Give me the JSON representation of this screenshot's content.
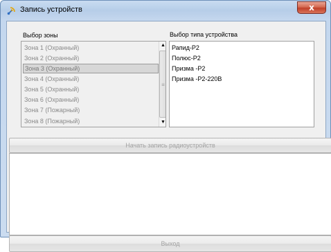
{
  "window": {
    "title": "Запись устройств",
    "close_glyph": "x"
  },
  "zones": {
    "label": "Выбор зоны",
    "items": [
      {
        "label": "Зона 1 (Охранный)"
      },
      {
        "label": "Зона 2 (Охранный)"
      },
      {
        "label": "Зона 3 (Охранный)"
      },
      {
        "label": "Зона 4 (Охранный)"
      },
      {
        "label": "Зона 5 (Охранный)"
      },
      {
        "label": "Зона 6 (Охранный)"
      },
      {
        "label": "Зона 7 (Пожарный)"
      },
      {
        "label": "Зона 8 (Пожарный)"
      }
    ],
    "selected": "Зона 3 (Охранный)",
    "scroll_up_glyph": "▲",
    "scroll_down_glyph": "▼",
    "scroll_thumb_glyph": "≡"
  },
  "device_types": {
    "label": "Выбор типа устройства",
    "items": [
      {
        "label": "Рапид-Р2"
      },
      {
        "label": "Полюс-Р2"
      },
      {
        "label": "Призма -Р2"
      },
      {
        "label": "Призма -Р2-220В"
      }
    ]
  },
  "actions": {
    "start_label": "Начать запись радиоустройств",
    "exit_label": "Выход"
  },
  "colors": {
    "title_bar": "#b6cde8",
    "close_button": "#c0412a",
    "disabled_text": "#a2a2a2"
  },
  "icons": {
    "title_icon": "app-satellite-icon"
  }
}
